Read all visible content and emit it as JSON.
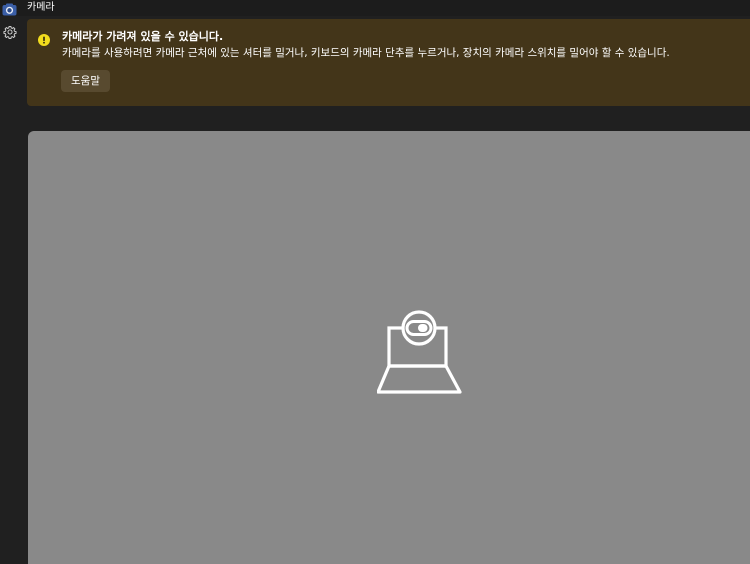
{
  "window": {
    "title": "카메라",
    "app_icon": "camera-app-icon"
  },
  "sidebar": {
    "settings_icon": "gear-icon"
  },
  "banner": {
    "icon": "warning-icon",
    "title": "카메라가 가려져 있을 수 있습니다.",
    "message": "카메라를 사용하려면 카메라 근처에 있는 셔터를 밀거나, 키보드의 카메라 단추를 누르거나, 장치의 카메라 스위치를 밀어야 할 수 있습니다.",
    "help_label": "도움말",
    "colors": {
      "background": "#433519",
      "icon": "#f2dc1e",
      "button": "#584a2f"
    }
  },
  "preview": {
    "icon": "camera-shutter-closed-icon",
    "colors": {
      "background": "#898989"
    }
  }
}
